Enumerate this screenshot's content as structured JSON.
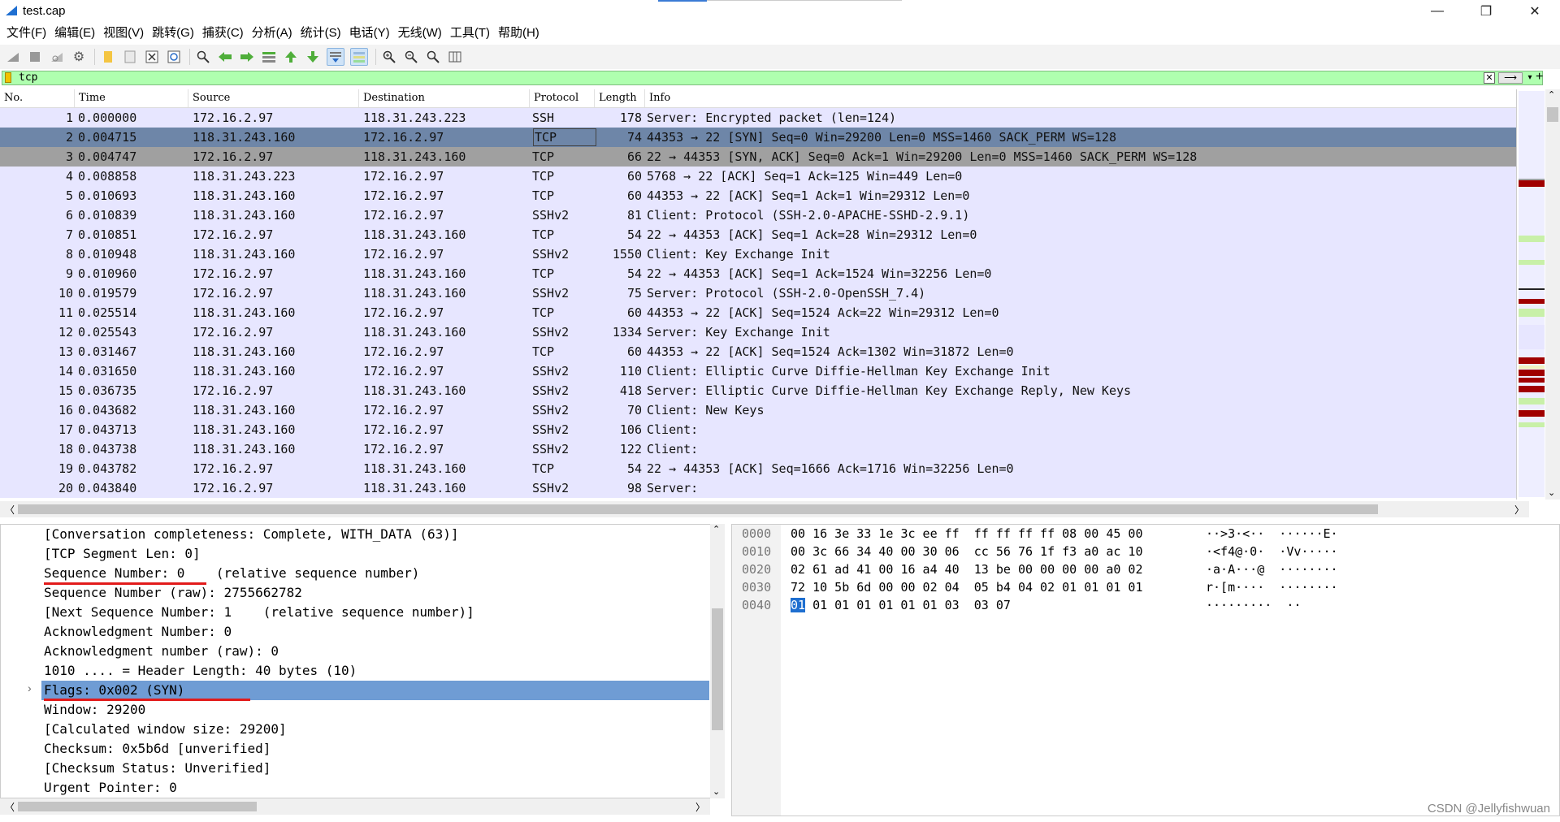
{
  "window": {
    "title": "test.cap"
  },
  "menu": [
    "文件(F)",
    "编辑(E)",
    "视图(V)",
    "跳转(G)",
    "捕获(C)",
    "分析(A)",
    "统计(S)",
    "电话(Y)",
    "无线(W)",
    "工具(T)",
    "帮助(H)"
  ],
  "toolbar_icons": [
    "shark-fin-start-icon",
    "stop-icon",
    "restart-icon",
    "options-gear-icon",
    "open-folder-icon",
    "save-icon",
    "close-file-icon",
    "reload-icon",
    "find-icon",
    "back-arrow-icon",
    "forward-arrow-icon",
    "go-to-packet-icon",
    "first-packet-icon",
    "last-packet-icon",
    "autoscroll-icon",
    "colorize-icon",
    "zoom-in-icon",
    "zoom-out-icon",
    "zoom-normal-icon",
    "resize-columns-icon"
  ],
  "filter": {
    "value": "tcp"
  },
  "packet_list": {
    "columns": [
      "No.",
      "Time",
      "Source",
      "Destination",
      "Protocol",
      "Length",
      "Info"
    ],
    "rows": [
      {
        "no": "1",
        "time": "0.000000",
        "src": "172.16.2.97",
        "dst": "118.31.243.223",
        "proto": "SSH",
        "len": "178",
        "info": "Server: Encrypted packet (len=124)"
      },
      {
        "no": "2",
        "time": "0.004715",
        "src": "118.31.243.160",
        "dst": "172.16.2.97",
        "proto": "TCP",
        "len": "74",
        "info": "44353 → 22 [SYN] Seq=0 Win=29200 Len=0 MSS=1460 SACK_PERM WS=128"
      },
      {
        "no": "3",
        "time": "0.004747",
        "src": "172.16.2.97",
        "dst": "118.31.243.160",
        "proto": "TCP",
        "len": "66",
        "info": "22 → 44353 [SYN, ACK] Seq=0 Ack=1 Win=29200 Len=0 MSS=1460 SACK_PERM WS=128"
      },
      {
        "no": "4",
        "time": "0.008858",
        "src": "118.31.243.223",
        "dst": "172.16.2.97",
        "proto": "TCP",
        "len": "60",
        "info": "5768 → 22 [ACK] Seq=1 Ack=125 Win=449 Len=0"
      },
      {
        "no": "5",
        "time": "0.010693",
        "src": "118.31.243.160",
        "dst": "172.16.2.97",
        "proto": "TCP",
        "len": "60",
        "info": "44353 → 22 [ACK] Seq=1 Ack=1 Win=29312 Len=0"
      },
      {
        "no": "6",
        "time": "0.010839",
        "src": "118.31.243.160",
        "dst": "172.16.2.97",
        "proto": "SSHv2",
        "len": "81",
        "info": "Client: Protocol (SSH-2.0-APACHE-SSHD-2.9.1)"
      },
      {
        "no": "7",
        "time": "0.010851",
        "src": "172.16.2.97",
        "dst": "118.31.243.160",
        "proto": "TCP",
        "len": "54",
        "info": "22 → 44353 [ACK] Seq=1 Ack=28 Win=29312 Len=0"
      },
      {
        "no": "8",
        "time": "0.010948",
        "src": "118.31.243.160",
        "dst": "172.16.2.97",
        "proto": "SSHv2",
        "len": "1550",
        "info": "Client: Key Exchange Init"
      },
      {
        "no": "9",
        "time": "0.010960",
        "src": "172.16.2.97",
        "dst": "118.31.243.160",
        "proto": "TCP",
        "len": "54",
        "info": "22 → 44353 [ACK] Seq=1 Ack=1524 Win=32256 Len=0"
      },
      {
        "no": "10",
        "time": "0.019579",
        "src": "172.16.2.97",
        "dst": "118.31.243.160",
        "proto": "SSHv2",
        "len": "75",
        "info": "Server: Protocol (SSH-2.0-OpenSSH_7.4)"
      },
      {
        "no": "11",
        "time": "0.025514",
        "src": "118.31.243.160",
        "dst": "172.16.2.97",
        "proto": "TCP",
        "len": "60",
        "info": "44353 → 22 [ACK] Seq=1524 Ack=22 Win=29312 Len=0"
      },
      {
        "no": "12",
        "time": "0.025543",
        "src": "172.16.2.97",
        "dst": "118.31.243.160",
        "proto": "SSHv2",
        "len": "1334",
        "info": "Server: Key Exchange Init"
      },
      {
        "no": "13",
        "time": "0.031467",
        "src": "118.31.243.160",
        "dst": "172.16.2.97",
        "proto": "TCP",
        "len": "60",
        "info": "44353 → 22 [ACK] Seq=1524 Ack=1302 Win=31872 Len=0"
      },
      {
        "no": "14",
        "time": "0.031650",
        "src": "118.31.243.160",
        "dst": "172.16.2.97",
        "proto": "SSHv2",
        "len": "110",
        "info": "Client: Elliptic Curve Diffie-Hellman Key Exchange Init"
      },
      {
        "no": "15",
        "time": "0.036735",
        "src": "172.16.2.97",
        "dst": "118.31.243.160",
        "proto": "SSHv2",
        "len": "418",
        "info": "Server: Elliptic Curve Diffie-Hellman Key Exchange Reply, New Keys"
      },
      {
        "no": "16",
        "time": "0.043682",
        "src": "118.31.243.160",
        "dst": "172.16.2.97",
        "proto": "SSHv2",
        "len": "70",
        "info": "Client: New Keys"
      },
      {
        "no": "17",
        "time": "0.043713",
        "src": "118.31.243.160",
        "dst": "172.16.2.97",
        "proto": "SSHv2",
        "len": "106",
        "info": "Client:"
      },
      {
        "no": "18",
        "time": "0.043738",
        "src": "118.31.243.160",
        "dst": "172.16.2.97",
        "proto": "SSHv2",
        "len": "122",
        "info": "Client:"
      },
      {
        "no": "19",
        "time": "0.043782",
        "src": "172.16.2.97",
        "dst": "118.31.243.160",
        "proto": "TCP",
        "len": "54",
        "info": "22 → 44353 [ACK] Seq=1666 Ack=1716 Win=32256 Len=0"
      },
      {
        "no": "20",
        "time": "0.043840",
        "src": "172.16.2.97",
        "dst": "118.31.243.160",
        "proto": "SSHv2",
        "len": "98",
        "info": "Server:"
      }
    ],
    "selected_row": "2"
  },
  "details": [
    "[Conversation completeness: Complete, WITH_DATA (63)]",
    "[TCP Segment Len: 0]",
    "Sequence Number: 0    (relative sequence number)",
    "Sequence Number (raw): 2755662782",
    "[Next Sequence Number: 1    (relative sequence number)]",
    "Acknowledgment Number: 0",
    "Acknowledgment number (raw): 0",
    "1010 .... = Header Length: 40 bytes (10)",
    "Flags: 0x002 (SYN)",
    "Window: 29200",
    "[Calculated window size: 29200]",
    "Checksum: 0x5b6d [unverified]",
    "[Checksum Status: Unverified]",
    "Urgent Pointer: 0"
  ],
  "bytes": {
    "offsets": [
      "0000",
      "0010",
      "0020",
      "0030",
      "0040"
    ],
    "hex": [
      "00 16 3e 33 1e 3c ee ff  ff ff ff ff 08 00 45 00",
      "00 3c 66 34 40 00 30 06  cc 56 76 1f f3 a0 ac 10",
      "02 61 ad 41 00 16 a4 40  13 be 00 00 00 00 a0 02",
      "72 10 5b 6d 00 00 02 04  05 b4 04 02 01 01 01 01",
      "01 01 01 01 01 01 03  03 07"
    ],
    "ascii": [
      "··>3·<··  ······E·",
      "·<f4@·0·  ·Vv·····",
      "·a·A···@  ········",
      "r·[m····  ········",
      "·········  ··"
    ],
    "selected_byte": "01"
  },
  "watermark": "CSDN @Jellyfishwuan",
  "colors": {
    "row_bg": "#e7e6ff",
    "selected": "#6e86a8",
    "filter_ok": "#afffaf",
    "detail_highlight": "#6f9cd4",
    "annotation": "#e21b1b"
  }
}
